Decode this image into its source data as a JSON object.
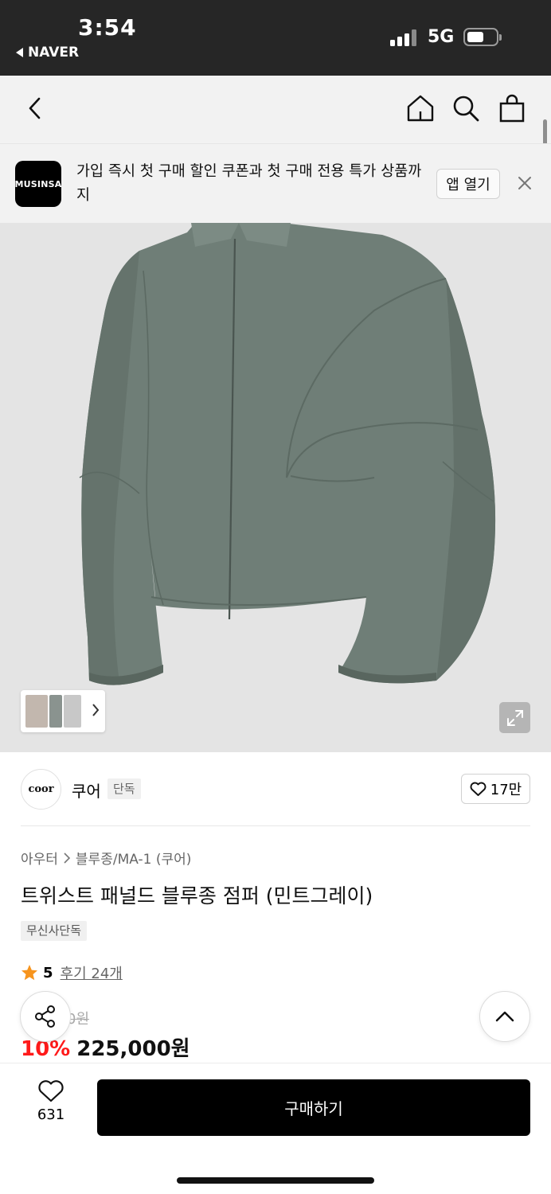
{
  "status_bar": {
    "time": "3:54",
    "back_app": "NAVER",
    "network": "5G",
    "battery_level": 0.6
  },
  "nav": {
    "icons": [
      "back-arrow-icon",
      "home-icon",
      "search-icon",
      "shopping-bag-icon"
    ]
  },
  "app_banner": {
    "logo_text": "MUSINSA",
    "message": "가입 즉시 첫 구매 할인 쿠폰과 첫 구매 전용 특가 상품까지",
    "open_label": "앱 열기"
  },
  "product": {
    "brand_logo_text": "coor",
    "brand_name": "쿠어",
    "brand_tag": "단독",
    "like_count": "17만",
    "breadcrumb": [
      "아우터",
      "블루종/MA-1 (쿠어)"
    ],
    "title": "트위스트 패널드 블루종 점퍼 (민트그레이)",
    "exclusive_badge": "무신사단독",
    "rating": "5",
    "review_label": "후기 24개",
    "original_price_partial": "0원",
    "discount_partial": "10%",
    "price": "225,000원",
    "image_colors": {
      "jacket": "#6f7e77",
      "background": "#e4e4e4"
    }
  },
  "bottom_bar": {
    "wish_count": "631",
    "buy_label": "구매하기"
  },
  "colors": {
    "accent_discount": "#ff1a1a",
    "rating_star": "#f7941d",
    "buy_button": "#000000"
  }
}
